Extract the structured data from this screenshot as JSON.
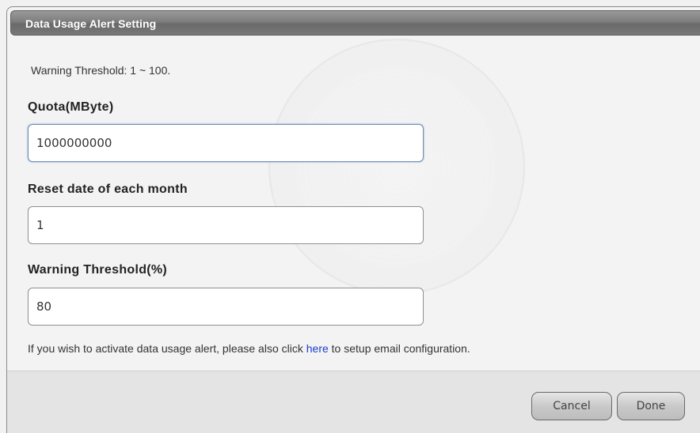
{
  "dialog": {
    "title": "Data Usage Alert Setting",
    "hint": "Warning Threshold: 1 ~ 100."
  },
  "fields": {
    "quota": {
      "label": "Quota(MByte)",
      "value": "1000000000"
    },
    "reset_date": {
      "label": "Reset date of each month",
      "value": "1"
    },
    "warning_threshold": {
      "label": "Warning Threshold(%)",
      "value": "80"
    }
  },
  "note": {
    "before": "If you wish to activate data usage alert, please also click ",
    "link": "here",
    "after": " to setup email configuration."
  },
  "buttons": {
    "cancel": "Cancel",
    "done": "Done"
  }
}
